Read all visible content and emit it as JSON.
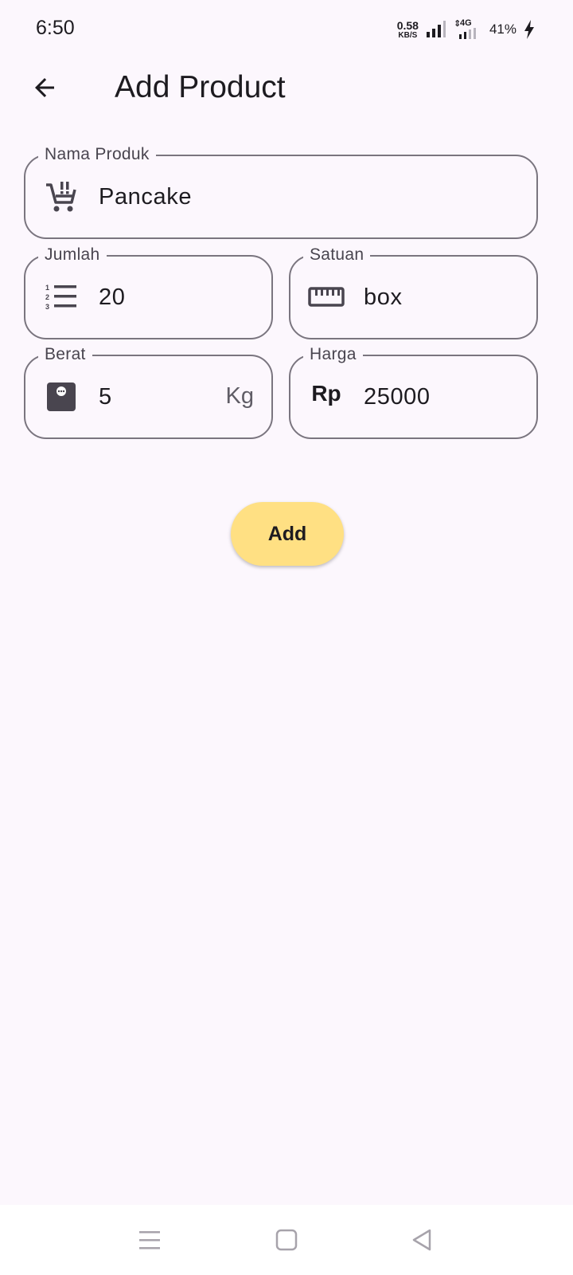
{
  "status_bar": {
    "time": "6:50",
    "net_speed_value": "0.58",
    "net_speed_unit": "KB/S",
    "network_type": "4G",
    "battery": "41%"
  },
  "app_bar": {
    "title": "Add Product",
    "back_icon": "arrow-back-icon"
  },
  "form": {
    "nama_produk": {
      "label": "Nama Produk",
      "value": "Pancake",
      "icon": "cart-icon"
    },
    "jumlah": {
      "label": "Jumlah",
      "value": "20",
      "icon": "numbered-list-icon"
    },
    "satuan": {
      "label": "Satuan",
      "value": "box",
      "icon": "ruler-icon"
    },
    "berat": {
      "label": "Berat",
      "value": "5",
      "suffix": "Kg",
      "icon": "scale-icon"
    },
    "harga": {
      "label": "Harga",
      "value": "25000",
      "prefix": "Rp"
    }
  },
  "add_button": {
    "label": "Add",
    "color": "#ffe083"
  },
  "nav_bar": {
    "items": [
      "menu-icon",
      "home-square-icon",
      "back-triangle-icon"
    ]
  },
  "colors": {
    "background": "#fcf7fd",
    "outline": "#7a757f",
    "text": "#1d1b20"
  }
}
